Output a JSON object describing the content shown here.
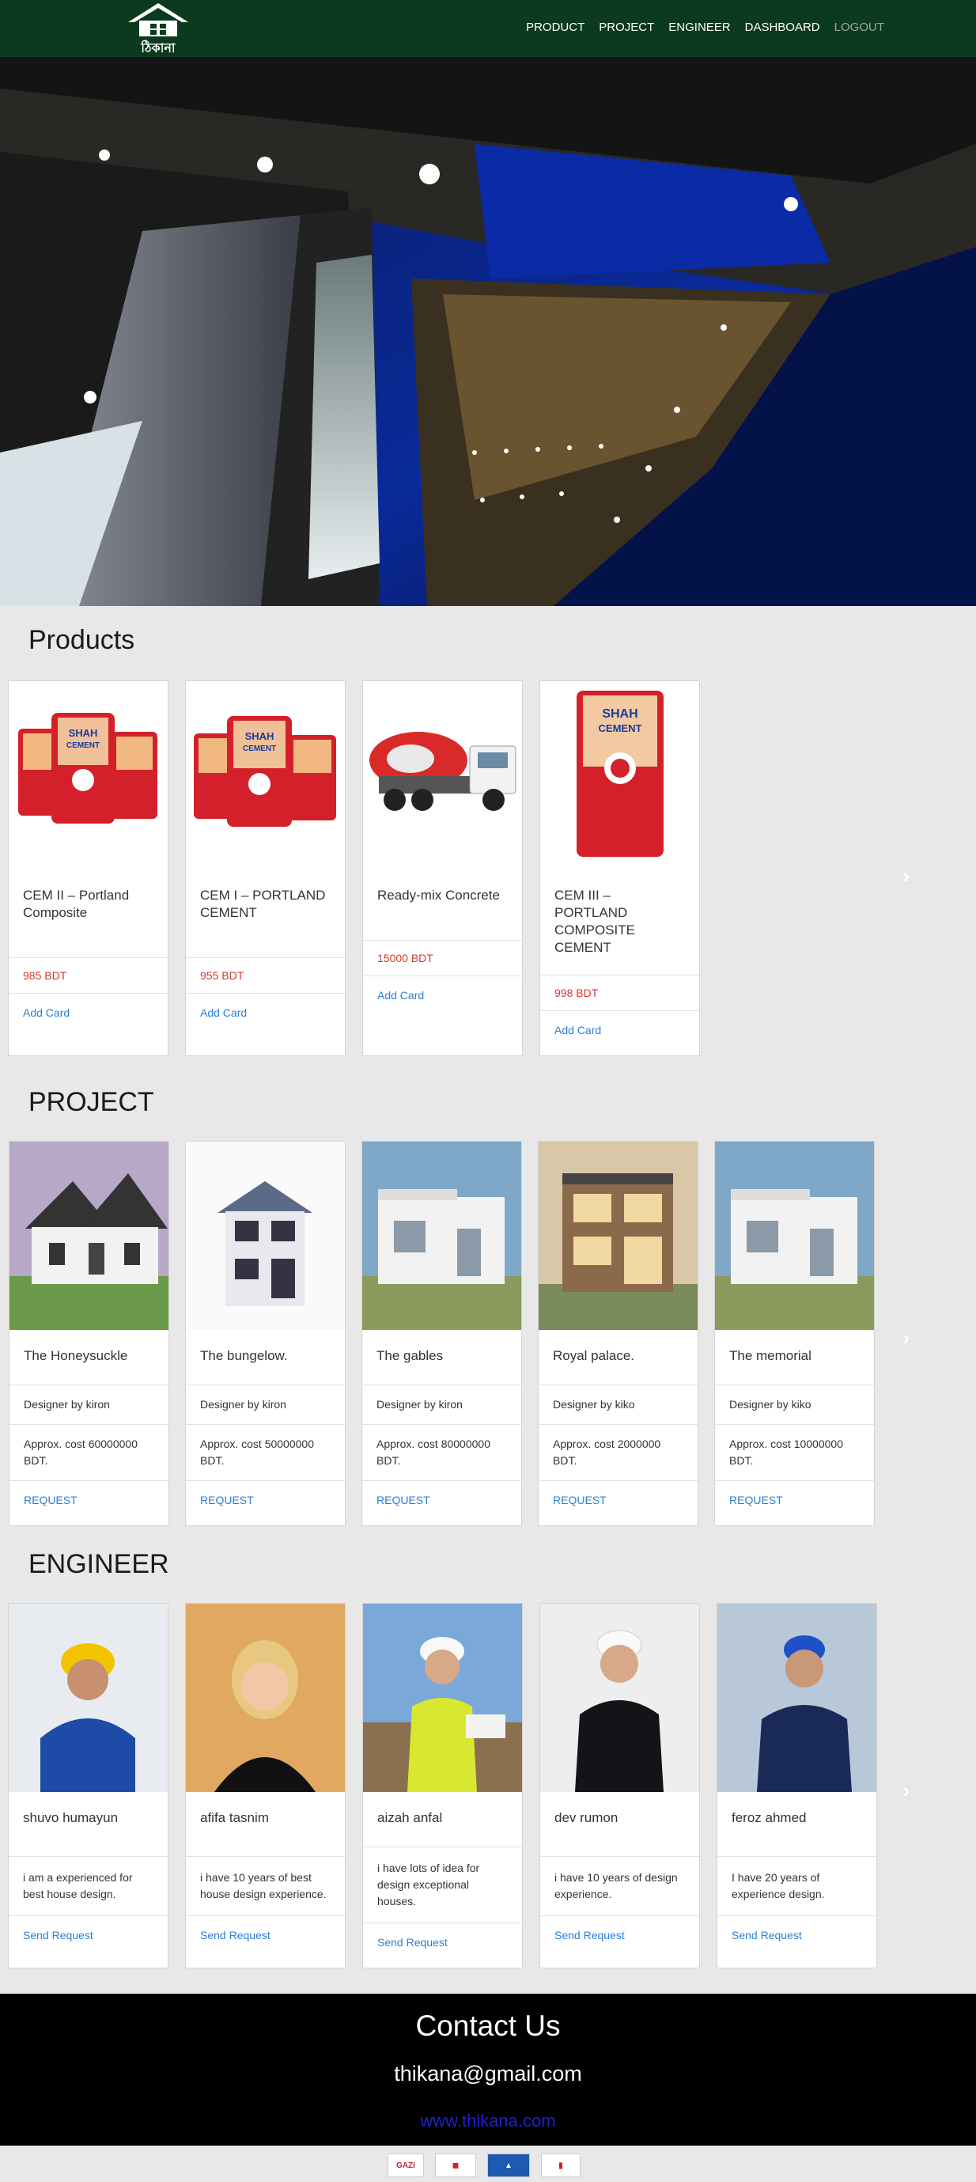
{
  "nav": {
    "logo_text": "ঠিকানা",
    "links": [
      "PRODUCT",
      "PROJECT",
      "ENGINEER",
      "DASHBOARD"
    ],
    "logout": "LOGOUT"
  },
  "products": {
    "title": "Products",
    "items": [
      {
        "name": "CEM II – Portland Composite",
        "price": "985 BDT",
        "action": "Add Card",
        "image": "cement-bags"
      },
      {
        "name": "CEM I – PORTLAND CEMENT",
        "price": "955 BDT",
        "action": "Add Card",
        "image": "cement-bags"
      },
      {
        "name": "Ready-mix Concrete",
        "price": "15000 BDT",
        "action": "Add Card",
        "image": "mixer-truck"
      },
      {
        "name": "CEM III – PORTLAND COMPOSITE CEMENT",
        "price": "998 BDT",
        "action": "Add Card",
        "image": "cement-bag"
      }
    ]
  },
  "project": {
    "title": "PROJECT",
    "items": [
      {
        "name": "The Honeysuckle",
        "designer": "Designer by kiron",
        "cost": "Approx. cost 60000000 BDT.",
        "action": "REQUEST"
      },
      {
        "name": "The bungelow.",
        "designer": "Designer by kiron",
        "cost": "Approx. cost 50000000 BDT.",
        "action": "REQUEST"
      },
      {
        "name": "The gables",
        "designer": "Designer by kiron",
        "cost": "Approx. cost 80000000 BDT.",
        "action": "REQUEST"
      },
      {
        "name": "Royal palace.",
        "designer": "Designer by kiko",
        "cost": "Approx. cost 2000000 BDT.",
        "action": "REQUEST"
      },
      {
        "name": "The memorial",
        "designer": "Designer by kiko",
        "cost": "Approx. cost 10000000 BDT.",
        "action": "REQUEST"
      }
    ]
  },
  "engineer": {
    "title": "ENGINEER",
    "items": [
      {
        "name": "shuvo humayun",
        "bio": "i am a experienced for best house design.",
        "action": "Send Request"
      },
      {
        "name": "afifa tasnim",
        "bio": "i have 10 years of best house design experience.",
        "action": "Send Request"
      },
      {
        "name": "aizah anfal",
        "bio": "i have lots of idea for design exceptional houses.",
        "action": "Send Request"
      },
      {
        "name": "dev rumon",
        "bio": "i have 10 years of design experience.",
        "action": "Send Request"
      },
      {
        "name": "feroz ahmed",
        "bio": "I have 20 years of experience design.",
        "action": "Send Request"
      }
    ]
  },
  "contact": {
    "title": "Contact Us",
    "email": "thikana@gmail.com",
    "website": "www.thikana.com"
  },
  "colors": {
    "nav_bg": "#0c3a1e",
    "price": "#d23a2f",
    "link": "#2a7fd6",
    "contact_bg": "#000000",
    "website_link": "#2020c8"
  }
}
